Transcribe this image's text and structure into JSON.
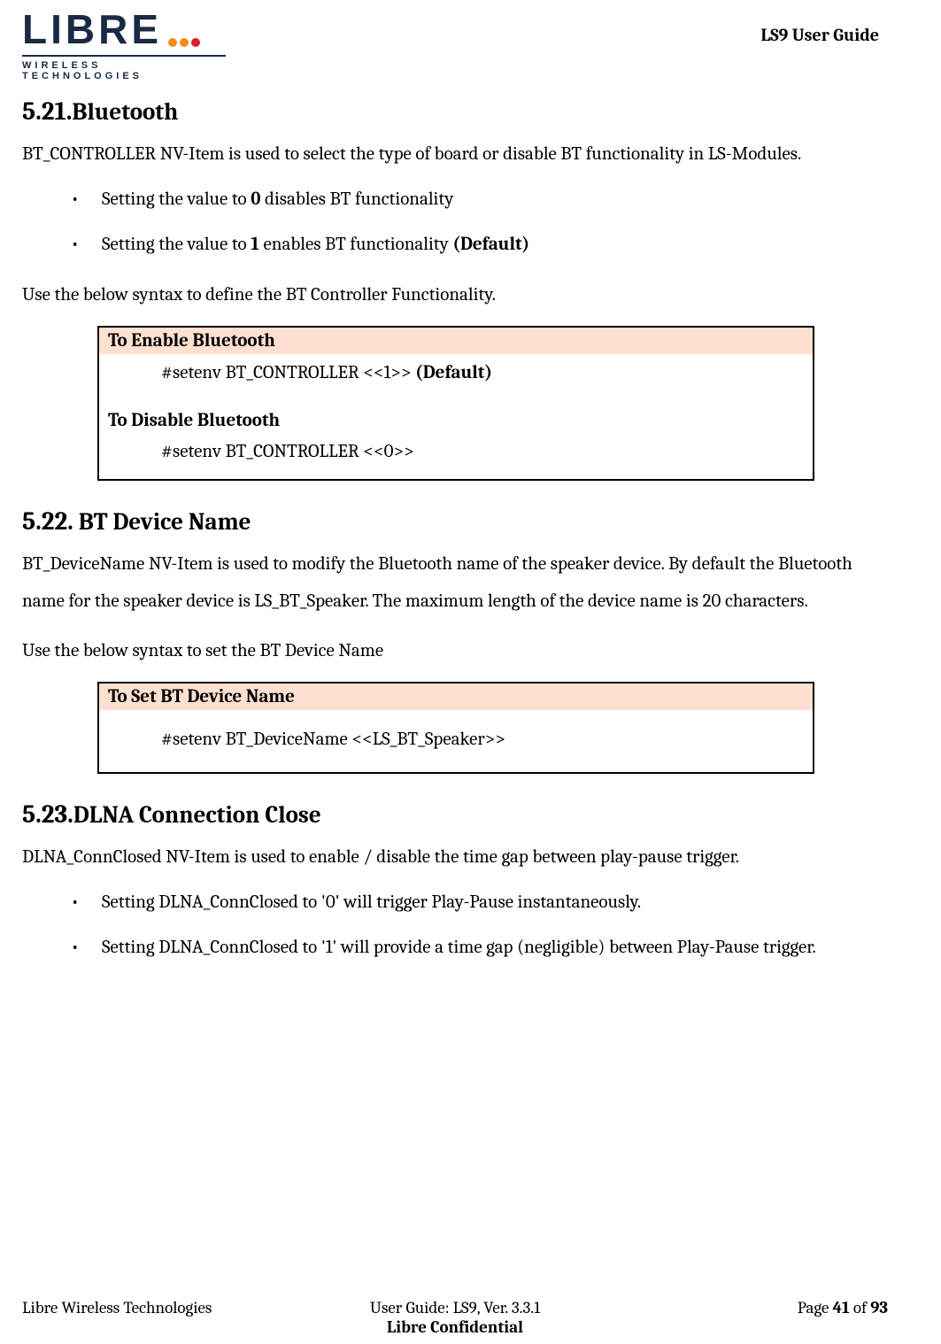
{
  "header": {
    "logo_main": "LIBRE",
    "logo_sub": "WIRELESS TECHNOLOGIES",
    "doc_title": "LS9 User Guide"
  },
  "sections": {
    "s521": {
      "num": "5.21.",
      "title": "Bluetooth",
      "p1": "BT_CONTROLLER NV-Item is used to select the type of board or disable BT functionality in LS-Modules.",
      "b1_a": "Setting the value to ",
      "b1_bold": "0",
      "b1_b": " disables BT functionality",
      "b2_a": "Setting the value to ",
      "b2_bold": "1",
      "b2_b": " enables BT functionality  ",
      "b2_def": "(Default)",
      "p2": "Use the below syntax to define the BT Controller Functionality.",
      "box_head": "To Enable Bluetooth",
      "box_cmd1_a": "#setenv BT_CONTROLLER <<1>> ",
      "box_cmd1_b": "(Default)",
      "box_sub": "To Disable Bluetooth",
      "box_cmd2": "#setenv BT_CONTROLLER <<0>>"
    },
    "s522": {
      "num": "5.22.",
      "title": " BT Device Name",
      "p1": "BT_DeviceName NV-Item is used to modify the Bluetooth name of the speaker device. By default the Bluetooth name for the speaker device is LS_BT_Speaker. The maximum length of the device name is 20 characters.",
      "p2": "Use the below syntax to set the BT Device Name",
      "box_head": "To Set BT Device Name",
      "box_cmd": "#setenv BT_DeviceName <<LS_BT_Speaker>>"
    },
    "s523": {
      "num": "5.23.",
      "title": "DLNA Connection Close",
      "p1": "DLNA_ConnClosed NV-Item is used to enable / disable the time gap between play-pause trigger.",
      "b1": "Setting DLNA_ConnClosed to '0' will trigger Play-Pause instantaneously.",
      "b2": "Setting DLNA_ConnClosed to '1' will provide a time gap (negligible) between Play-Pause trigger."
    }
  },
  "footer": {
    "left": "Libre Wireless Technologies",
    "center1": "User Guide: LS9, Ver. 3.3.1",
    "center2": "Libre Confidential",
    "right_a": "Page ",
    "right_pg": "41",
    "right_b": " of ",
    "right_total": "93"
  }
}
